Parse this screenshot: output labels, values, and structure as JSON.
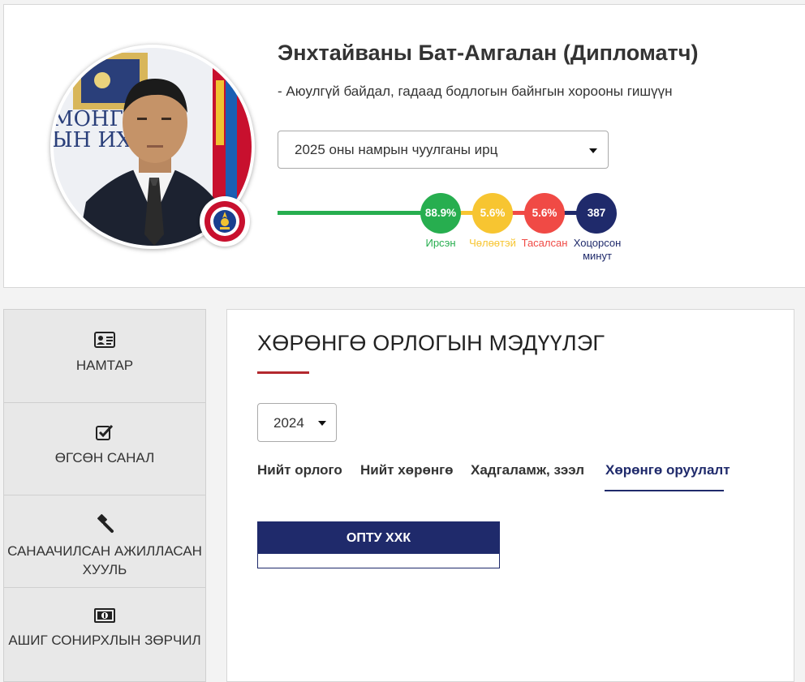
{
  "profile": {
    "name": "Энхтайваны Бат-Амгалан (Дипломатч)",
    "role": "- Аюулгүй байдал, гадаад бодлогын байнгын хорооны гишүүн",
    "photo_sign_lines": [
      "МОНГО",
      "ЫН ИХ Х"
    ]
  },
  "session_select": {
    "value": "2025 оны намрын чуулганы ирц"
  },
  "attendance": [
    {
      "value": "88.9%",
      "label": "Ирсэн",
      "color": "#27ae4f"
    },
    {
      "value": "5.6%",
      "label": "Чөлөөтэй",
      "color": "#f7c531"
    },
    {
      "value": "5.6%",
      "label": "Тасалсан",
      "color": "#f04a45"
    },
    {
      "value": "387",
      "label": "Хоцорсон минут",
      "color": "#1f2a6b"
    }
  ],
  "sidebar": {
    "items": [
      {
        "label": "НАМТАР",
        "icon": "id-card-icon"
      },
      {
        "label": "ӨГСӨН САНАЛ",
        "icon": "checkbox-icon"
      },
      {
        "label": "САНААЧИЛСАН АЖИЛЛАСАН ХУУЛЬ",
        "icon": "gavel-icon"
      },
      {
        "label": "АШИГ СОНИРХЛЫН ЗӨРЧИЛ",
        "icon": "money-bill-icon"
      }
    ]
  },
  "main": {
    "title": "ХӨРӨНГӨ ОРЛОГЫН МЭДҮҮЛЭГ",
    "year_select": {
      "value": "2024"
    },
    "tabs": [
      {
        "label": "Нийт орлого",
        "active": false
      },
      {
        "label": "Нийт хөрөнгө",
        "active": false
      },
      {
        "label": "Хадгаламж, зээл",
        "active": false
      },
      {
        "label": "Хөрөнгө оруулалт",
        "active": true
      }
    ],
    "company": {
      "name": "ОПТУ ХХК"
    }
  },
  "colors": {
    "accent_red": "#b3282e",
    "navy": "#1f2a6b"
  }
}
